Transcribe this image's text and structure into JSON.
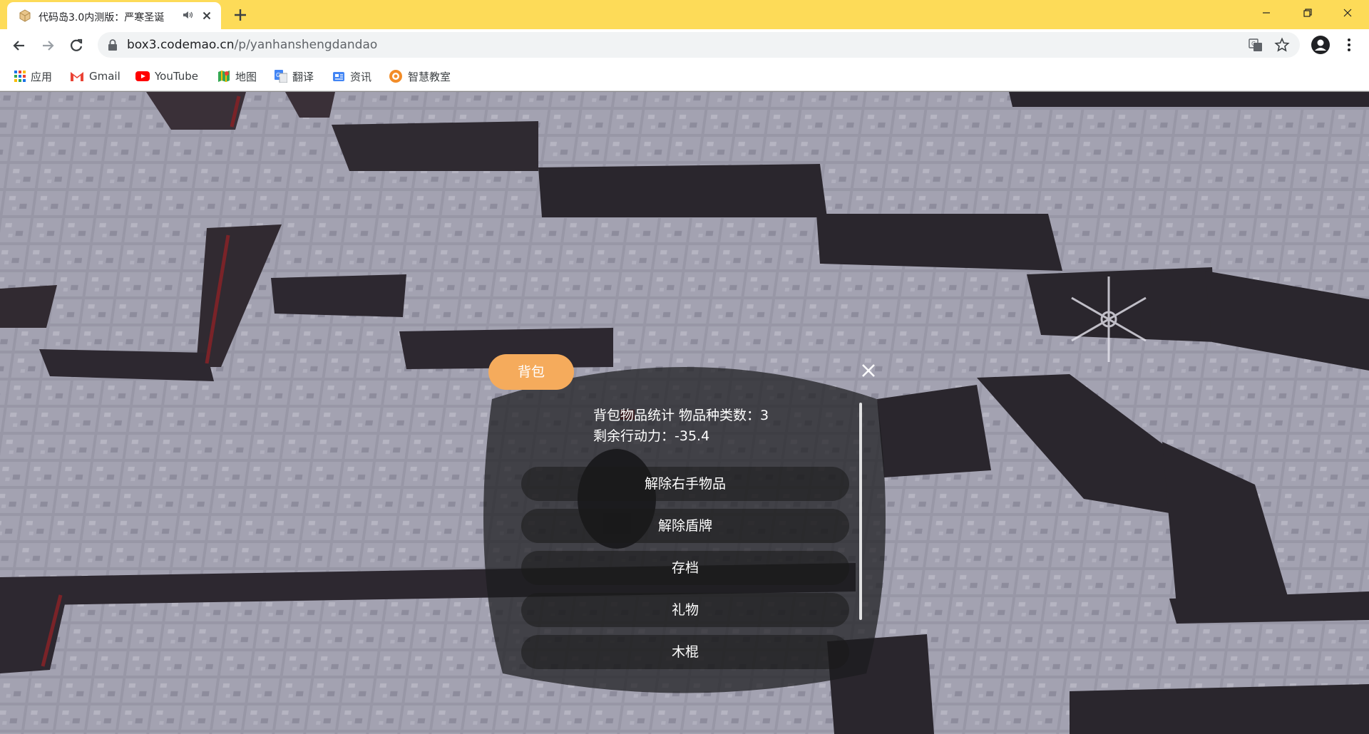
{
  "browser": {
    "tab": {
      "title": "代码岛3.0内测版：严寒圣诞",
      "favicon": "box-icon",
      "audio": "speaker-icon",
      "close": "close-icon"
    },
    "new_tab": "plus-icon",
    "window_controls": [
      "minimize-icon",
      "restore-icon",
      "close-icon"
    ],
    "address": {
      "host": "box3.codemao.cn",
      "path": "/p/yanhanshengdandao"
    },
    "bookmarks": [
      {
        "label": "应用",
        "icon": "apps-grid-icon"
      },
      {
        "label": "Gmail",
        "icon": "gmail-icon"
      },
      {
        "label": "YouTube",
        "icon": "youtube-icon"
      },
      {
        "label": "地图",
        "icon": "maps-icon"
      },
      {
        "label": "翻译",
        "icon": "translate-icon"
      },
      {
        "label": "资讯",
        "icon": "news-icon"
      },
      {
        "label": "智慧教室",
        "icon": "classroom-icon"
      }
    ],
    "colors": {
      "tabbar": "#fddb58",
      "omnibox": "#f1f3f4"
    }
  },
  "panel": {
    "tab_label": "背包",
    "info_line1": "背包物品统计 物品种类数：3",
    "info_line2": "剩余行动力：-35.4",
    "buttons": [
      "解除右手物品",
      "解除盾牌",
      "存档",
      "礼物",
      "木棍"
    ],
    "accent": "#f5ab5c"
  }
}
